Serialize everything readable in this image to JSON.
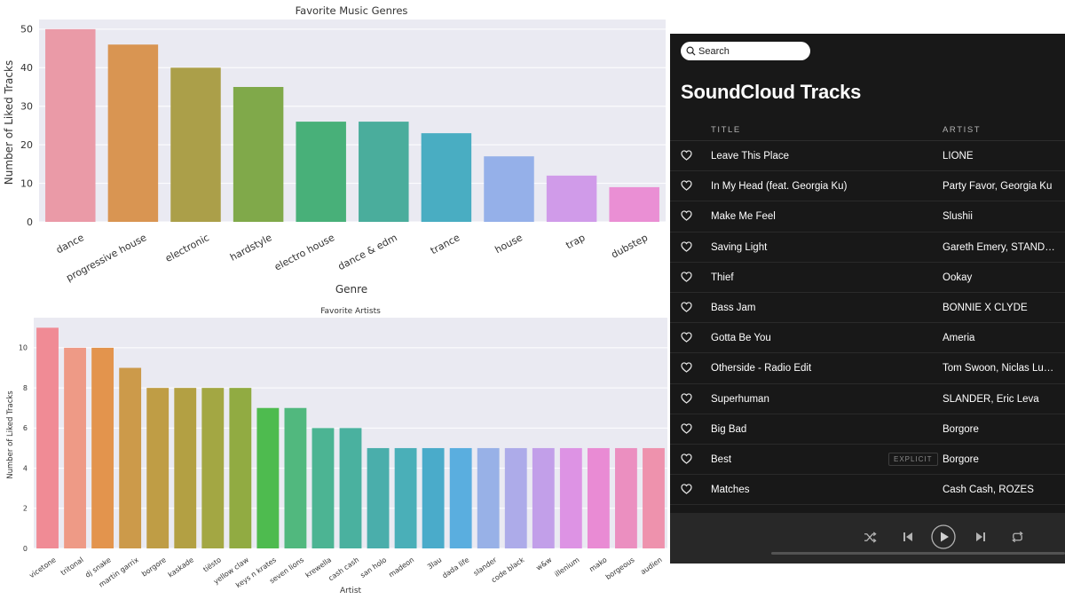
{
  "chart_data": [
    {
      "type": "bar",
      "title": "Favorite Music Genres",
      "xlabel": "Genre",
      "ylabel": "Number of Liked Tracks",
      "ylim": [
        0,
        52.5
      ],
      "yticks": [
        0,
        10,
        20,
        30,
        40,
        50
      ],
      "grid": true,
      "categories": [
        "dance",
        "progressive house",
        "electronic",
        "hardstyle",
        "electro house",
        "dance & edm",
        "trance",
        "house",
        "trap",
        "dubstep"
      ],
      "values": [
        50,
        46,
        40,
        35,
        26,
        26,
        23,
        17,
        12,
        9
      ],
      "colors": [
        "#ea9aa7",
        "#d99552",
        "#ab9f49",
        "#80a94a",
        "#48b079",
        "#4aad9c",
        "#49adc2",
        "#95b0e9",
        "#d09be9",
        "#ea8fd4"
      ]
    },
    {
      "type": "bar",
      "title": "Favorite Artists",
      "xlabel": "Artist",
      "ylabel": "Number of Liked Tracks",
      "ylim": [
        0,
        11.5
      ],
      "yticks": [
        0,
        2,
        4,
        6,
        8,
        10
      ],
      "grid": true,
      "categories": [
        "vicetone",
        "tritonal",
        "dj snake",
        "martin garrix",
        "borgore",
        "kaskade",
        "tiësto",
        "yellow claw",
        "keys n krates",
        "seven lions",
        "krewella",
        "cash cash",
        "san holo",
        "madeon",
        "3lau",
        "dada life",
        "slander",
        "code black",
        "w&w",
        "illenium",
        "mako",
        "borgeous",
        "audien"
      ],
      "values": [
        11,
        10,
        10,
        9,
        8,
        8,
        8,
        8,
        7,
        7,
        6,
        6,
        5,
        5,
        5,
        5,
        5,
        5,
        5,
        5,
        5,
        5,
        5
      ],
      "colors": [
        "#f08b95",
        "#ee9a86",
        "#e3944d",
        "#cc9a4a",
        "#bf9d45",
        "#b3a043",
        "#a3a743",
        "#91ab42",
        "#4ebb4f",
        "#51b87e",
        "#4cb493",
        "#4ab19f",
        "#4aaeab",
        "#4aafb8",
        "#4aabca",
        "#5aaedf",
        "#98b1e7",
        "#adabe9",
        "#c29fe9",
        "#dd93e4",
        "#e98bd4",
        "#eb8fc0",
        "#ee92ad"
      ]
    }
  ],
  "soundcloud": {
    "search_placeholder": "Search",
    "title": "SoundCloud Tracks",
    "columns": {
      "title": "TITLE",
      "artist": "ARTIST"
    },
    "tracks": [
      {
        "title": "Leave This Place",
        "artist": "LIONE"
      },
      {
        "title": "In My Head (feat. Georgia Ku)",
        "artist": "Party Favor, Georgia Ku"
      },
      {
        "title": "Make Me Feel",
        "artist": "Slushii"
      },
      {
        "title": "Saving Light",
        "artist": "Gareth Emery, STANDERWICK"
      },
      {
        "title": "Thief",
        "artist": "Ookay"
      },
      {
        "title": "Bass Jam",
        "artist": "BONNIE X CLYDE"
      },
      {
        "title": "Gotta Be You",
        "artist": "Ameria"
      },
      {
        "title": "Otherside - Radio Edit",
        "artist": "Tom Swoon, Niclas Lundin"
      },
      {
        "title": "Superhuman",
        "artist": "SLANDER, Eric Leva"
      },
      {
        "title": "Big Bad",
        "artist": "Borgore"
      },
      {
        "title": "Best",
        "artist": "Borgore",
        "badge": "EXPLICIT"
      },
      {
        "title": "Matches",
        "artist": "Cash Cash, ROZES"
      }
    ],
    "player": {
      "shuffle_icon": "shuffle-icon",
      "prev_icon": "previous-icon",
      "play_icon": "play-icon",
      "next_icon": "next-icon",
      "repeat_icon": "repeat-icon"
    }
  }
}
